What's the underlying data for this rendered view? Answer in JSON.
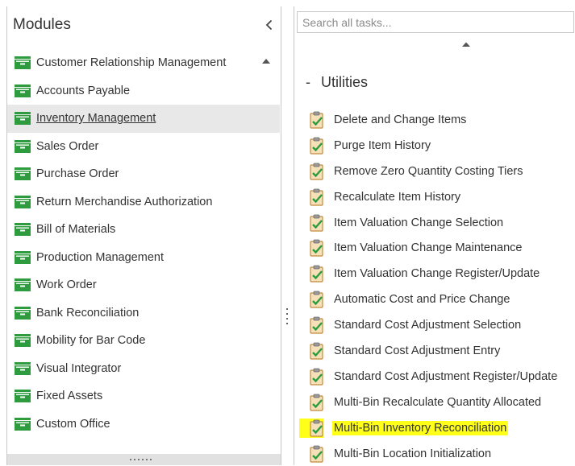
{
  "modules": {
    "title": "Modules",
    "items": [
      {
        "label": "Customer Relationship Management",
        "selected": false
      },
      {
        "label": "Accounts Payable",
        "selected": false
      },
      {
        "label": "Inventory Management",
        "selected": true
      },
      {
        "label": "Sales Order",
        "selected": false
      },
      {
        "label": "Purchase Order",
        "selected": false
      },
      {
        "label": "Return Merchandise Authorization",
        "selected": false
      },
      {
        "label": "Bill of Materials",
        "selected": false
      },
      {
        "label": "Production Management",
        "selected": false
      },
      {
        "label": "Work Order",
        "selected": false
      },
      {
        "label": "Bank Reconciliation",
        "selected": false
      },
      {
        "label": "Mobility for Bar Code",
        "selected": false
      },
      {
        "label": "Visual Integrator",
        "selected": false
      },
      {
        "label": "Fixed Assets",
        "selected": false
      },
      {
        "label": "Custom Office",
        "selected": false
      }
    ],
    "icon": "green-module-folder-icon"
  },
  "tasks": {
    "search_placeholder": "Search all tasks...",
    "group": {
      "toggle": "-",
      "title": "Utilities"
    },
    "items": [
      {
        "label": "Delete and Change Items",
        "highlighted": false
      },
      {
        "label": "Purge Item History",
        "highlighted": false
      },
      {
        "label": "Remove Zero Quantity Costing Tiers",
        "highlighted": false
      },
      {
        "label": "Recalculate Item History",
        "highlighted": false
      },
      {
        "label": "Item Valuation Change Selection",
        "highlighted": false
      },
      {
        "label": "Item Valuation Change Maintenance",
        "highlighted": false
      },
      {
        "label": "Item Valuation Change Register/Update",
        "highlighted": false
      },
      {
        "label": "Automatic Cost and Price Change",
        "highlighted": false
      },
      {
        "label": "Standard Cost Adjustment Selection",
        "highlighted": false
      },
      {
        "label": "Standard Cost Adjustment Entry",
        "highlighted": false
      },
      {
        "label": "Standard Cost Adjustment Register/Update",
        "highlighted": false
      },
      {
        "label": "Multi-Bin Recalculate Quantity Allocated",
        "highlighted": false
      },
      {
        "label": "Multi-Bin Inventory Reconciliation",
        "highlighted": true
      },
      {
        "label": "Multi-Bin Location Initialization",
        "highlighted": false
      }
    ],
    "icon": "clipboard-check-icon"
  },
  "colors": {
    "module_icon": "#2e9b3e",
    "selected_row": "#e8e8e8",
    "highlight": "#ffff1a"
  }
}
